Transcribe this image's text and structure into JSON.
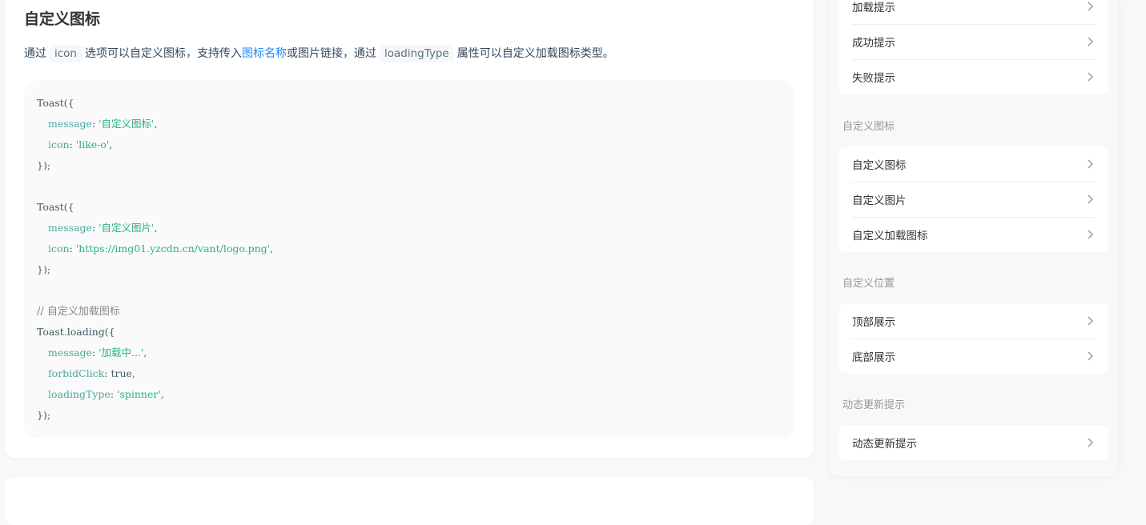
{
  "section": {
    "title": "自定义图标",
    "desc_1": "通过",
    "code_icon": "icon",
    "desc_2": "选项可以自定义图标，支持传入",
    "link": "图标名称",
    "desc_3": "或图片链接，通过",
    "code_loading_type": "loadingType",
    "desc_4": "属性可以自定义加载图标类型。"
  },
  "code": {
    "l1": "Toast({",
    "l2_key": "message",
    "l2_val": "'自定义图标'",
    "l3_key": "icon",
    "l3_val": "'like-o'",
    "l4": "});",
    "l6": "Toast({",
    "l7_key": "message",
    "l7_val": "'自定义图片'",
    "l8_key": "icon",
    "l8_val": "'https://img01.yzcdn.cn/vant/logo.png'",
    "l9": "});",
    "l11": "// 自定义加载图标",
    "l12": "Toast.loading({",
    "l13_key": "message",
    "l13_val": "'加载中...'",
    "l14_key": "forbidClick",
    "l14_val": "true",
    "l15_key": "loadingType",
    "l15_val": "'spinner'",
    "l16": "});"
  },
  "sidebar": {
    "group1_items": [
      "加载提示",
      "成功提示",
      "失败提示"
    ],
    "group2_title": "自定义图标",
    "group2_items": [
      "自定义图标",
      "自定义图片",
      "自定义加载图标"
    ],
    "group3_title": "自定义位置",
    "group3_items": [
      "顶部展示",
      "底部展示"
    ],
    "group4_title": "动态更新提示",
    "group4_items": [
      "动态更新提示"
    ]
  },
  "icons": {
    "cell_arrow": "chevron-right-icon"
  },
  "colors": {
    "link": "#1989fa",
    "string": "#2bb08a",
    "key": "#4ea69c"
  }
}
